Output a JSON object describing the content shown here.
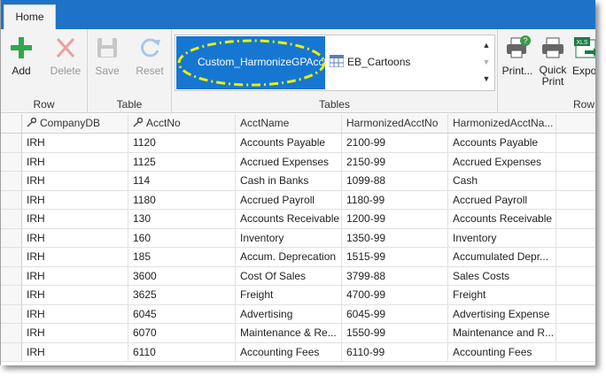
{
  "tabs": [
    {
      "label": "Home"
    }
  ],
  "ribbon": {
    "groups": {
      "row": "Row",
      "table": "Table",
      "tables": "Tables",
      "row2": "Row"
    },
    "buttons": {
      "add": "Add",
      "delete": "Delete",
      "save": "Save",
      "reset": "Reset",
      "print": "Print...",
      "quick_print_line1": "Quick",
      "quick_print_line2": "Print",
      "export": "Expor"
    },
    "tables_gallery": {
      "selected": "Custom_HarmonizeGPAccts",
      "other": "EB_Cartoons"
    },
    "colors": {
      "tab_strip": "#1e73c8",
      "selected": "#1677d2",
      "highlight": "#e8f000"
    }
  },
  "grid": {
    "columns": [
      "CompanyDB",
      "AcctNo",
      "AcctName",
      "HarmonizedAcctNo",
      "HarmonizedAcctNa..."
    ],
    "rows": [
      [
        "IRH",
        "1120",
        "Accounts Payable",
        "2100-99",
        "Accounts Payable"
      ],
      [
        "IRH",
        "1125",
        "Accrued Expenses",
        "2150-99",
        "Accrued Expenses"
      ],
      [
        "IRH",
        "114",
        "Cash in Banks",
        "1099-88",
        "Cash"
      ],
      [
        "IRH",
        "1180",
        "Accrued Payroll",
        "1180-99",
        "Accrued Payroll"
      ],
      [
        "IRH",
        "130",
        "Accounts Receivable",
        "1200-99",
        "Accounts Receivable"
      ],
      [
        "IRH",
        "160",
        "Inventory",
        "1350-99",
        "Inventory"
      ],
      [
        "IRH",
        "185",
        "Accum. Deprecation",
        "1515-99",
        "Accumulated Depr..."
      ],
      [
        "IRH",
        "3600",
        "Cost Of Sales",
        "3799-88",
        "Sales Costs"
      ],
      [
        "IRH",
        "3625",
        "Freight",
        "4700-99",
        "Freight"
      ],
      [
        "IRH",
        "6045",
        "Advertising",
        "6045-99",
        "Advertising Expense"
      ],
      [
        "IRH",
        "6070",
        "Maintenance & Re...",
        "1550-99",
        "Maintenance and R..."
      ],
      [
        "IRH",
        "6110",
        "Accounting Fees",
        "6110-99",
        "Accounting Fees"
      ]
    ]
  }
}
